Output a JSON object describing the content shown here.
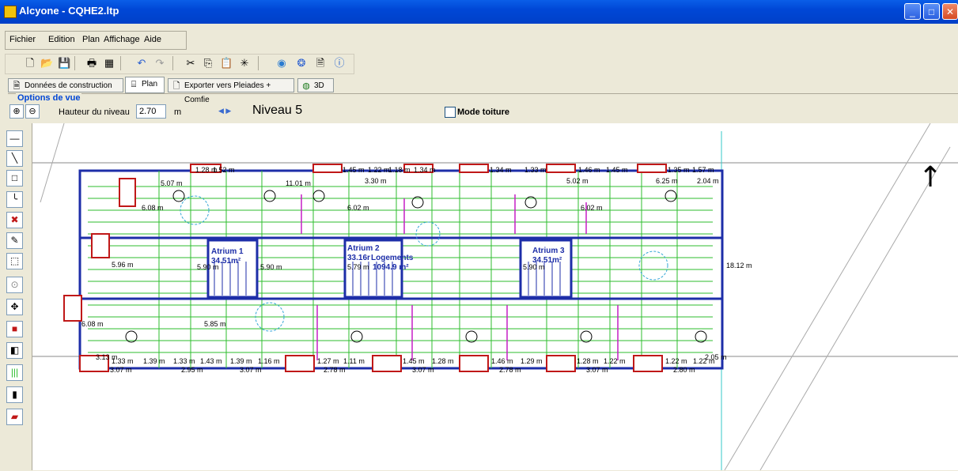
{
  "window": {
    "title": "Alcyone - CQHE2.ltp",
    "controls": [
      "_",
      "□",
      "✕"
    ]
  },
  "menu": [
    "Fichier",
    "Edition",
    "Plan",
    "Affichage",
    "Aide"
  ],
  "toolbar_icons": [
    "new-icon",
    "open-icon",
    "save-icon",
    "print-icon",
    "preview-icon",
    "undo-icon",
    "redo-icon",
    "cut-icon",
    "copy-icon",
    "paste-icon",
    "delete-icon",
    "help-icon",
    "info-icon",
    "report-icon",
    "about-icon"
  ],
  "tabs": [
    {
      "label": "Données de construction",
      "icon": "document-icon",
      "active": false
    },
    {
      "label": "Plan",
      "icon": "plan-icon",
      "active": true
    },
    {
      "label": "Exporter vers Pleiades + Comfie",
      "icon": "export-icon",
      "active": false
    },
    {
      "label": "3D",
      "icon": "globe-icon",
      "active": false
    }
  ],
  "options": {
    "legend": "Options de vue",
    "height_label": "Hauteur du niveau",
    "height_value": "2.70",
    "height_unit": "m",
    "level_title": "Niveau 5",
    "roof_mode_label": "Mode toiture",
    "roof_mode_checked": false
  },
  "side_tools": [
    "wall-line-tool",
    "diagonal-tool",
    "rectangle-tool",
    "curve-tool",
    "delete-tool",
    "edit-tool",
    "select-tool",
    "dimension-tool",
    "move-tool",
    "fill-tool",
    "door-tool",
    "window-tool",
    "column-tool",
    "exit-tool"
  ],
  "plan": {
    "atriums": [
      {
        "name": "Atrium 1",
        "area": "34.51m²"
      },
      {
        "name": "Atrium 2",
        "area": "33.16r"
      },
      {
        "name": "Atrium 3",
        "area": "34.51m²"
      }
    ],
    "zone_label": "Logements",
    "zone_area": "1094.9 m²",
    "dimensions_top": [
      "1.28 m",
      "1.52 m",
      "1.45 m",
      "1.22 m",
      "1.18 m",
      "1.34 m",
      "1.34 m",
      "1.33 m",
      "1.46 m",
      "1.45 m",
      "1.35 m",
      "1.57 m",
      "3.30 m",
      "5.02 m",
      "6.25 m",
      "2.04 m",
      "11.01 m",
      "5.07 m"
    ],
    "dimensions_middle": [
      "6.08 m",
      "6.02 m",
      "6.02 m",
      "5.96 m",
      "5.90 m",
      "5.90 m",
      "5.79 m",
      "5.90 m",
      "18.12 m",
      "6.08 m",
      "5.85 m"
    ],
    "dimensions_bottom": [
      "3.13 m",
      "1.33 m",
      "1.39 m",
      "1.33 m",
      "1.43 m",
      "1.39 m",
      "1.16 m",
      "1.27 m",
      "1.11 m",
      "1.45 m",
      "1.28 m",
      "1.46 m",
      "1.29 m",
      "1.28 m",
      "1.22 m",
      "1.22 m",
      "1.22 m",
      "3.07 m",
      "2.95 m",
      "3.07 m",
      "2.78 m",
      "3.07 m",
      "2.78 m",
      "3.07 m",
      "2.80 m",
      "2.05 m"
    ],
    "north_arrow": "↑"
  }
}
